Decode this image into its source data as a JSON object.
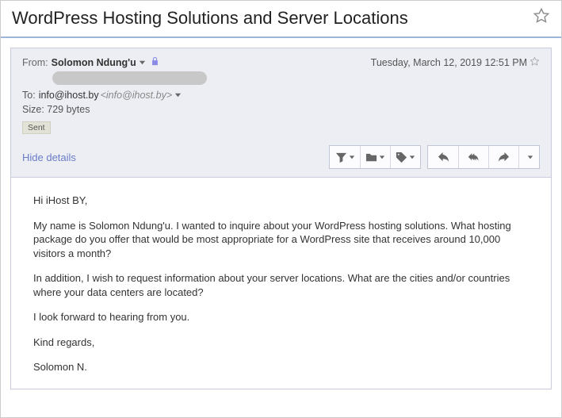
{
  "subject": "WordPress Hosting Solutions and Server Locations",
  "header": {
    "from_label": "From:",
    "from_name": "Solomon Ndung'u",
    "date": "Tuesday, March 12, 2019 12:51 PM",
    "to_label": "To:",
    "to_display": "info@ihost.by",
    "to_email_bracket": "<info@ihost.by>",
    "size_line": "Size: 729 bytes",
    "sent_tag": "Sent",
    "hide_details": "Hide details"
  },
  "body": {
    "p1": "Hi iHost BY,",
    "p2": "My name is Solomon Ndung'u. I wanted to inquire about your WordPress hosting solutions. What hosting package do you offer that would be most appropriate for a WordPress site that receives around 10,000 visitors a month?",
    "p3": "In addition, I wish to request information about your server locations. What are the cities and/or countries where your data centers are located?",
    "p4": "I look forward to hearing from you.",
    "p5": "Kind regards,",
    "p6": "Solomon N."
  }
}
